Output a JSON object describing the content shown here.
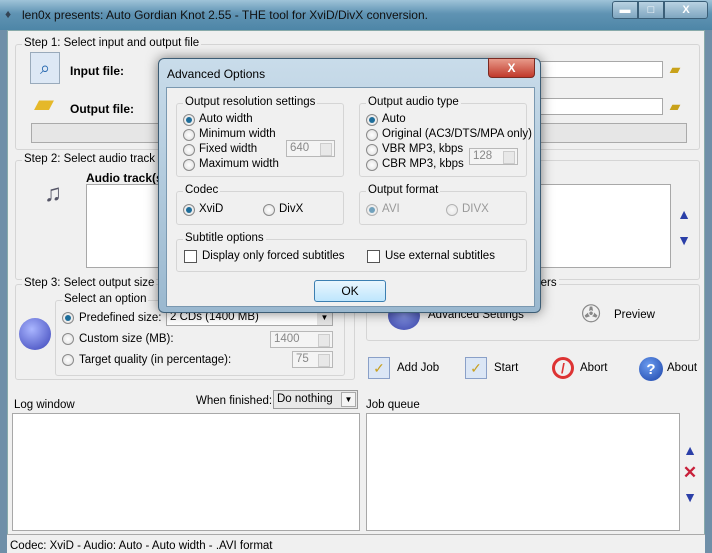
{
  "window": {
    "title": "len0x presents: Auto Gordian Knot 2.55 - THE tool for XviD/DivX conversion.",
    "minimize": "▬",
    "maximize": "□",
    "close": "X"
  },
  "step1": {
    "title": "Step 1: Select input and output file",
    "input_label": "Input file:",
    "output_label": "Output file:",
    "input_value": "",
    "output_value": ""
  },
  "step2": {
    "title": "Step 2: Select audio track a",
    "audio_label": "Audio track(s"
  },
  "step3": {
    "title": "Step 3: Select output size",
    "option_title": "Select an option",
    "predefined_label": "Predefined size:",
    "predefined_value": "2 CDs (1400 MB)",
    "custom_label": "Custom size (MB):",
    "custom_value": "1400",
    "quality_label": "Target quality (in percentage):",
    "quality_value": "75",
    "selected": "predefined"
  },
  "step4": {
    "title": "eters",
    "advanced_label": "Advanced Settings",
    "preview_label": "Preview"
  },
  "actions": {
    "add_job": "Add Job",
    "start": "Start",
    "abort": "Abort",
    "about": "About"
  },
  "log": {
    "label": "Log window",
    "when_finished_label": "When finished:",
    "when_finished_value": "Do nothing"
  },
  "queue": {
    "label": "Job queue"
  },
  "status": "Codec: XviD -   Audio: Auto -   Auto width - .AVI format",
  "dialog": {
    "title": "Advanced Options",
    "close": "X",
    "resolution": {
      "title": "Output resolution settings",
      "options": [
        "Auto width",
        "Minimum width",
        "Fixed width",
        "Maximum width"
      ],
      "selected": 0,
      "width_value": "640"
    },
    "audio": {
      "title": "Output audio type",
      "options": [
        "Auto",
        "Original (AC3/DTS/MPA only)",
        "VBR MP3, kbps",
        "CBR MP3, kbps"
      ],
      "selected": 0,
      "kbps_value": "128"
    },
    "codec": {
      "title": "Codec",
      "options": [
        "XviD",
        "DivX"
      ],
      "selected": 0
    },
    "format": {
      "title": "Output format",
      "options": [
        "AVI",
        "DIVX"
      ],
      "selected": 0
    },
    "subtitle": {
      "title": "Subtitle options",
      "forced": "Display only forced subtitles",
      "external": "Use external subtitles",
      "forced_checked": false,
      "external_checked": false
    },
    "ok": "OK"
  }
}
